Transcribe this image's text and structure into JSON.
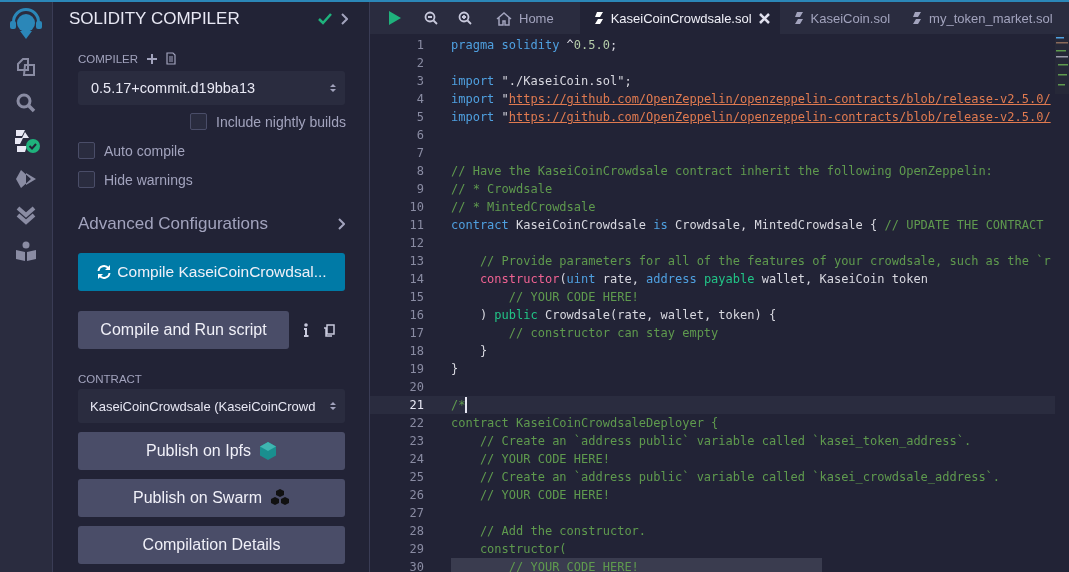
{
  "plugin_bar": [
    {
      "kind": "files",
      "selected": false
    },
    {
      "kind": "search",
      "selected": false
    },
    {
      "kind": "compiler",
      "selected": true
    },
    {
      "kind": "deploy",
      "selected": false
    },
    {
      "kind": "verify",
      "selected": false
    },
    {
      "kind": "learn",
      "selected": false
    }
  ],
  "panel": {
    "title": "SOLIDITY COMPILER",
    "compiled": true,
    "compiler_label": "COMPILER",
    "compiler_version": "0.5.17+commit.d19bba13",
    "nightly": {
      "label": "Include nightly builds",
      "checked": false
    },
    "options": [
      {
        "label": "Auto compile",
        "checked": false
      },
      {
        "label": "Hide warnings",
        "checked": false
      }
    ],
    "advanced_label": "Advanced Configurations",
    "compile_button": "Compile KaseiCoinCrowdsal...",
    "run_button": "Compile and Run script",
    "contract_label": "CONTRACT",
    "contract": "KaseiCoinCrowdsale (KaseiCoinCrowd",
    "buttons": [
      {
        "kind": "ipfs",
        "label": "Publish on Ipfs"
      },
      {
        "kind": "swarm",
        "label": "Publish on Swarm"
      },
      {
        "kind": "plain",
        "label": "Compilation Details"
      }
    ]
  },
  "editor": {
    "tabs": [
      {
        "kind": "home",
        "label": "Home",
        "selected": false,
        "closable": false
      },
      {
        "kind": "file",
        "label": "KaseiCoinCrowdsale.sol",
        "selected": true,
        "closable": true
      },
      {
        "kind": "file",
        "label": "KaseiCoin.sol",
        "selected": false,
        "closable": false
      },
      {
        "kind": "file",
        "label": "my_token_market.sol",
        "selected": false,
        "closable": false
      }
    ],
    "lines": [
      {
        "number": "1",
        "active": false,
        "marked": false,
        "tokens": [
          {
            "kind": "keyword",
            "text": "pragma solidity"
          },
          {
            "kind": "plain",
            "text": " ^"
          },
          {
            "kind": "number",
            "text": "0.5.0"
          },
          {
            "kind": "plain",
            "text": ";"
          }
        ]
      },
      {
        "number": "2",
        "active": false,
        "marked": false
      },
      {
        "number": "3",
        "active": false,
        "marked": false,
        "tokens": [
          {
            "kind": "keyword",
            "text": "import"
          },
          {
            "kind": "plain",
            "text": " \"./KaseiCoin.sol\";"
          }
        ]
      },
      {
        "number": "4",
        "active": false,
        "marked": false,
        "tokens": [
          {
            "kind": "keyword",
            "text": "import"
          },
          {
            "kind": "plain",
            "text": " \""
          },
          {
            "kind": "link",
            "text": "https://github.com/OpenZeppelin/openzeppelin-contracts/blob/release-v2.5.0/"
          }
        ]
      },
      {
        "number": "5",
        "active": false,
        "marked": false,
        "tokens": [
          {
            "kind": "keyword",
            "text": "import"
          },
          {
            "kind": "plain",
            "text": " \""
          },
          {
            "kind": "link",
            "text": "https://github.com/OpenZeppelin/openzeppelin-contracts/blob/release-v2.5.0/"
          }
        ]
      },
      {
        "number": "6",
        "active": false,
        "marked": false
      },
      {
        "number": "7",
        "active": false,
        "marked": false
      },
      {
        "number": "8",
        "active": false,
        "marked": false,
        "tokens": [
          {
            "kind": "comment",
            "text": "// Have the KaseiCoinCrowdsale contract inherit the following OpenZeppelin:"
          }
        ]
      },
      {
        "number": "9",
        "active": false,
        "marked": false,
        "tokens": [
          {
            "kind": "comment",
            "text": "// * Crowdsale"
          }
        ]
      },
      {
        "number": "10",
        "active": false,
        "marked": false,
        "tokens": [
          {
            "kind": "comment",
            "text": "// * MintedCrowdsale"
          }
        ]
      },
      {
        "number": "11",
        "active": false,
        "marked": false,
        "tokens": [
          {
            "kind": "keyword",
            "text": "contract"
          },
          {
            "kind": "plain",
            "text": " KaseiCoinCrowdsale "
          },
          {
            "kind": "keyword",
            "text": "is"
          },
          {
            "kind": "plain",
            "text": " Crowdsale, MintedCrowdsale { "
          },
          {
            "kind": "comment",
            "text": "// UPDATE THE CONTRACT"
          }
        ]
      },
      {
        "number": "12",
        "active": false,
        "marked": false
      },
      {
        "number": "13",
        "active": false,
        "marked": false,
        "tokens": [
          {
            "kind": "comment",
            "text": "    // Provide parameters for all of the features of your crowdsale, such as the `r"
          }
        ]
      },
      {
        "number": "14",
        "active": false,
        "marked": false,
        "tokens": [
          {
            "kind": "function",
            "text": "    constructor"
          },
          {
            "kind": "plain",
            "text": "("
          },
          {
            "kind": "keyword",
            "text": "uint"
          },
          {
            "kind": "plain",
            "text": " rate, "
          },
          {
            "kind": "keyword",
            "text": "address"
          },
          {
            "kind": "modifier",
            "text": " payable"
          },
          {
            "kind": "plain",
            "text": " wallet, KaseiCoin token"
          }
        ]
      },
      {
        "number": "15",
        "active": false,
        "marked": false,
        "tokens": [
          {
            "kind": "comment",
            "text": "        // YOUR CODE HERE!"
          }
        ]
      },
      {
        "number": "16",
        "active": false,
        "marked": false,
        "tokens": [
          {
            "kind": "plain",
            "text": "    ) "
          },
          {
            "kind": "modifier",
            "text": "public"
          },
          {
            "kind": "plain",
            "text": " Crowdsale(rate, wallet, token) {"
          }
        ]
      },
      {
        "number": "17",
        "active": false,
        "marked": false,
        "tokens": [
          {
            "kind": "comment",
            "text": "        // constructor can stay empty"
          }
        ]
      },
      {
        "number": "18",
        "active": false,
        "marked": false,
        "tokens": [
          {
            "kind": "plain",
            "text": "    }"
          }
        ]
      },
      {
        "number": "19",
        "active": false,
        "marked": false,
        "tokens": [
          {
            "kind": "plain",
            "text": "}"
          }
        ]
      },
      {
        "number": "20",
        "active": false,
        "marked": false
      },
      {
        "number": "21",
        "active": true,
        "marked": false,
        "tokens": [
          {
            "kind": "comment",
            "text": "/*"
          }
        ]
      },
      {
        "number": "22",
        "active": false,
        "marked": false,
        "tokens": [
          {
            "kind": "comment",
            "text": "contract KaseiCoinCrowdsaleDeployer {"
          }
        ]
      },
      {
        "number": "23",
        "active": false,
        "marked": false,
        "tokens": [
          {
            "kind": "comment",
            "text": "    // Create an `address public` variable called `kasei_token_address`."
          }
        ]
      },
      {
        "number": "24",
        "active": false,
        "marked": false,
        "tokens": [
          {
            "kind": "comment",
            "text": "    // YOUR CODE HERE!"
          }
        ]
      },
      {
        "number": "25",
        "active": false,
        "marked": false,
        "tokens": [
          {
            "kind": "comment",
            "text": "    // Create an `address public` variable called `kasei_crowdsale_address`."
          }
        ]
      },
      {
        "number": "26",
        "active": false,
        "marked": false,
        "tokens": [
          {
            "kind": "comment",
            "text": "    // YOUR CODE HERE!"
          }
        ]
      },
      {
        "number": "27",
        "active": false,
        "marked": false
      },
      {
        "number": "28",
        "active": false,
        "marked": false,
        "tokens": [
          {
            "kind": "comment",
            "text": "    // Add the constructor."
          }
        ]
      },
      {
        "number": "29",
        "active": false,
        "marked": false,
        "tokens": [
          {
            "kind": "comment",
            "text": "    constructor("
          }
        ]
      },
      {
        "number": "30",
        "active": false,
        "marked": true,
        "tokens": [
          {
            "kind": "comment",
            "text": "        // YOUR CODE HERE!"
          }
        ]
      }
    ]
  }
}
